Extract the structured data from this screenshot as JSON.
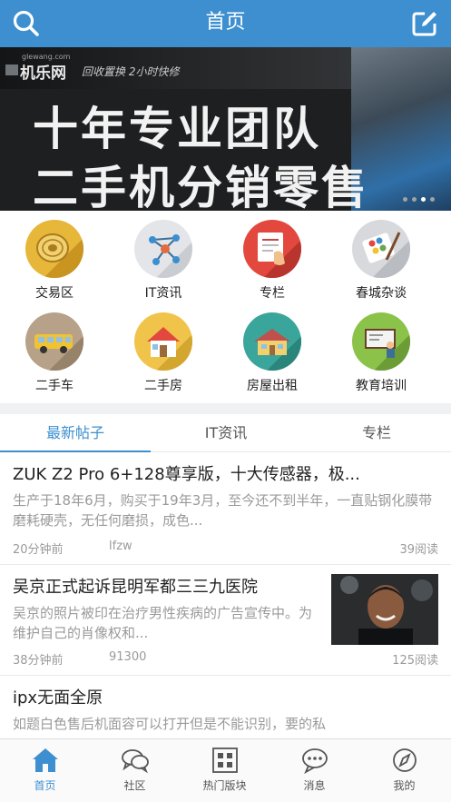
{
  "header": {
    "title": "首页",
    "search_icon": "search-icon",
    "compose_icon": "edit-icon",
    "color": "#3d8fd0"
  },
  "banner": {
    "url": "glewang.com",
    "brand": "机乐网",
    "tagline": "回收置换  2小时快修",
    "line1": "十年专业团队",
    "line2": "二手机分销零售",
    "slides": 4,
    "active_slide": 3
  },
  "categories": [
    {
      "label": "交易区",
      "icon": "coin-icon"
    },
    {
      "label": "IT资讯",
      "icon": "network-icon"
    },
    {
      "label": "专栏",
      "icon": "document-hand-icon"
    },
    {
      "label": "春城杂谈",
      "icon": "palette-icon"
    },
    {
      "label": "二手车",
      "icon": "car-icon"
    },
    {
      "label": "二手房",
      "icon": "house-icon"
    },
    {
      "label": "房屋出租",
      "icon": "rental-house-icon"
    },
    {
      "label": "教育培训",
      "icon": "blackboard-icon"
    }
  ],
  "tabs": [
    {
      "label": "最新帖子",
      "active": true
    },
    {
      "label": "IT资讯",
      "active": false
    },
    {
      "label": "专栏",
      "active": false
    }
  ],
  "posts": [
    {
      "title": "ZUK Z2 Pro 6+128尊享版，十大传感器，极...",
      "body": "生产于18年6月，购买于19年3月，至今还不到半年，一直贴钢化膜带磨耗硬壳，无任何磨损，成色...",
      "time": "20分钟前",
      "author": "lfzw",
      "reads": "39阅读"
    },
    {
      "title": "吴京正式起诉昆明军都三三九医院",
      "body": "吴京的照片被印在治疗男性疾病的广告宣传中。为维护自己的肖像权和...",
      "time": "38分钟前",
      "author": "91300",
      "reads": "125阅读"
    },
    {
      "title": "ipx无面全原",
      "body": "如题白色售后机面容可以打开但是不能识别，要的私"
    }
  ],
  "bottom_nav": [
    {
      "label": "首页",
      "icon": "home-icon",
      "active": true
    },
    {
      "label": "社区",
      "icon": "chat-bubbles-icon",
      "active": false
    },
    {
      "label": "热门版块",
      "icon": "grid-blocks-icon",
      "active": false
    },
    {
      "label": "消息",
      "icon": "message-icon",
      "active": false
    },
    {
      "label": "我的",
      "icon": "compass-icon",
      "active": false
    }
  ]
}
